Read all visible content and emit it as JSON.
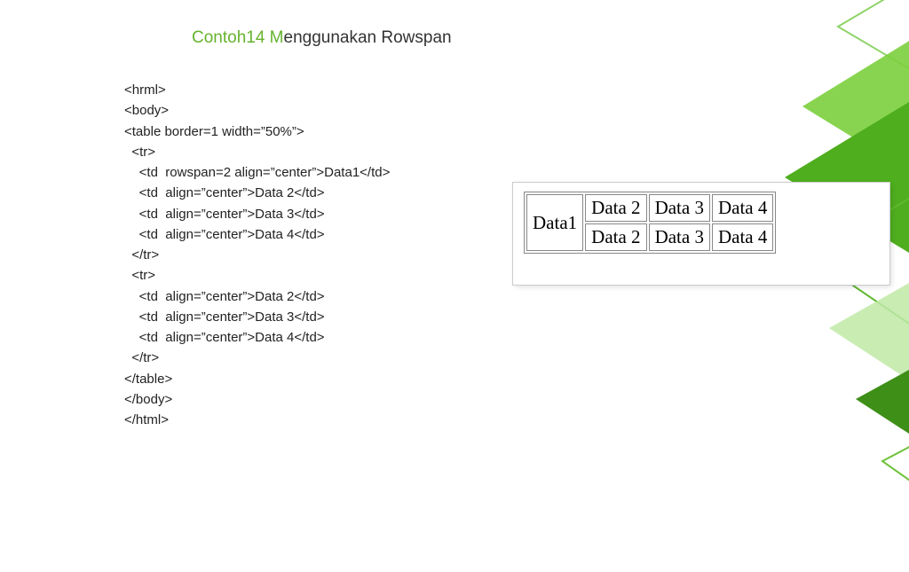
{
  "title_accent": "Contoh14  M",
  "title_rest": "enggunakan Rowspan",
  "code_lines": [
    "<hrml>",
    "<body>",
    "<table border=1 width=”50%”>",
    "  <tr>",
    "    <td  rowspan=2 align=”center”>Data1</td>",
    "    <td  align=”center”>Data 2</td>",
    "    <td  align=”center”>Data 3</td>",
    "    <td  align=”center”>Data 4</td>",
    "  </tr>",
    "  <tr>",
    "    <td  align=”center”>Data 2</td>",
    "    <td  align=”center”>Data 3</td>",
    "    <td  align=”center”>Data 4</td>",
    "  </tr>",
    "</table>",
    "</body>",
    "</html>"
  ],
  "table": {
    "row1": {
      "c1": "Data1",
      "c2": "Data 2",
      "c3": "Data 3",
      "c4": "Data 4"
    },
    "row2": {
      "c2": "Data 2",
      "c3": "Data 3",
      "c4": "Data 4"
    }
  }
}
